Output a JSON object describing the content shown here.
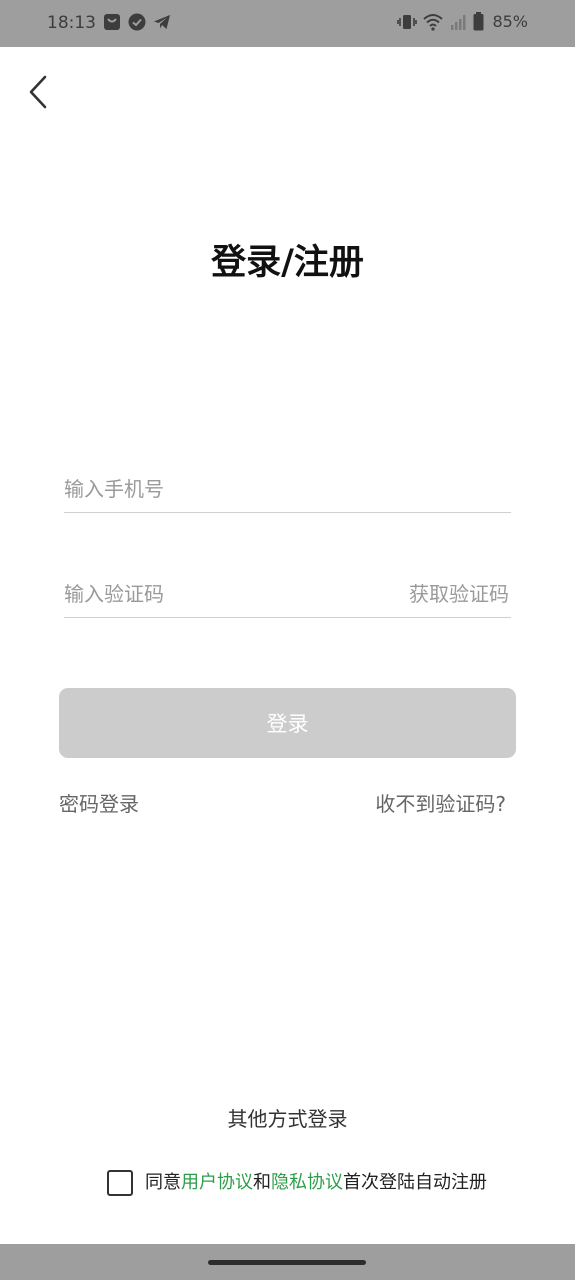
{
  "status_bar": {
    "time": "18:13",
    "battery": "85%",
    "left_icons": [
      "shopping-bag-icon",
      "check-circle-icon",
      "telegram-icon"
    ],
    "right_icons": [
      "vibrate-icon",
      "wifi-icon",
      "signal-icon",
      "battery-icon"
    ]
  },
  "header": {
    "back_icon": "chevron-left-icon"
  },
  "title": "登录/注册",
  "form": {
    "phone_placeholder": "输入手机号",
    "phone_value": "",
    "code_placeholder": "输入验证码",
    "code_value": "",
    "get_code_label": "获取验证码",
    "login_label": "登录"
  },
  "links": {
    "password_login": "密码登录",
    "no_code": "收不到验证码?"
  },
  "other_login": "其他方式登录",
  "agreement": {
    "checked": false,
    "prefix": "同意",
    "user_agreement": "用户协议",
    "and": "和",
    "privacy_agreement": "隐私协议",
    "suffix": "首次登陆自动注册"
  },
  "colors": {
    "accent": "#2e9e4b",
    "disabled_button": "#cccccc",
    "system_bar": "#9e9e9e"
  }
}
